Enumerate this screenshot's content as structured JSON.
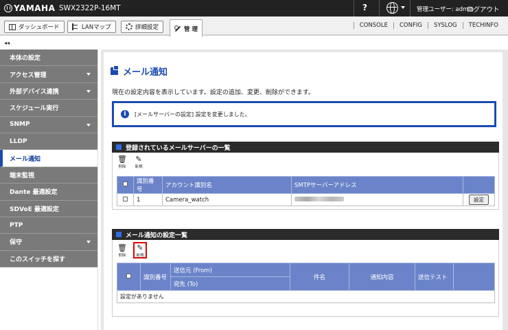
{
  "header": {
    "brand": "YAMAHA",
    "model": "SWX2322P-16MT",
    "help_label": "?",
    "user_label": "管理ユーザー: admin",
    "logout_label": "ログアウト"
  },
  "nav": {
    "tabs": [
      {
        "label": "ダッシュボード"
      },
      {
        "label": "LANマップ"
      },
      {
        "label": "詳細設定"
      },
      {
        "label": "管 理"
      }
    ],
    "links": [
      "CONSOLE",
      "CONFIG",
      "SYSLOG",
      "TECHINFO"
    ],
    "collapse_label": "◂◂"
  },
  "sidebar": {
    "items": [
      {
        "label": "本体の設定"
      },
      {
        "label": "アクセス管理"
      },
      {
        "label": "外部デバイス連携"
      },
      {
        "label": "スケジュール実行"
      },
      {
        "label": "SNMP"
      },
      {
        "label": "LLDP"
      },
      {
        "label": "メール通知"
      },
      {
        "label": "端末監視"
      },
      {
        "label": "Dante 最適設定"
      },
      {
        "label": "SDVoE 最適設定"
      },
      {
        "label": "PTP"
      },
      {
        "label": "保守"
      },
      {
        "label": "このスイッチを探す"
      }
    ]
  },
  "page": {
    "title": "メール通知",
    "description": "現在の設定内容を表示しています。設定の追加、変更、削除ができます。",
    "notice": "[メールサーバーの設定] 設定を変更しました。"
  },
  "servers": {
    "heading": "登録されているメールサーバーの一覧",
    "delete_label": "削除",
    "new_label": "新規",
    "columns": [
      "識別番号",
      "アカウント識別名",
      "SMTPサーバーアドレス"
    ],
    "rows": [
      {
        "id": "1",
        "account": "Camera_watch",
        "action": "設定"
      }
    ]
  },
  "notify": {
    "heading": "メール通知の設定一覧",
    "delete_label": "削除",
    "new_label": "新規",
    "col_id": "識別番号",
    "col_from": "送信元 (From)",
    "col_to": "宛先 (To)",
    "col_subject": "件名",
    "col_content": "通知内容",
    "col_test": "送信テスト",
    "empty": "設定がありません"
  },
  "colors": {
    "accent": "#1a4bb0",
    "table_header": "#6b84c9",
    "highlight": "#e00000"
  }
}
